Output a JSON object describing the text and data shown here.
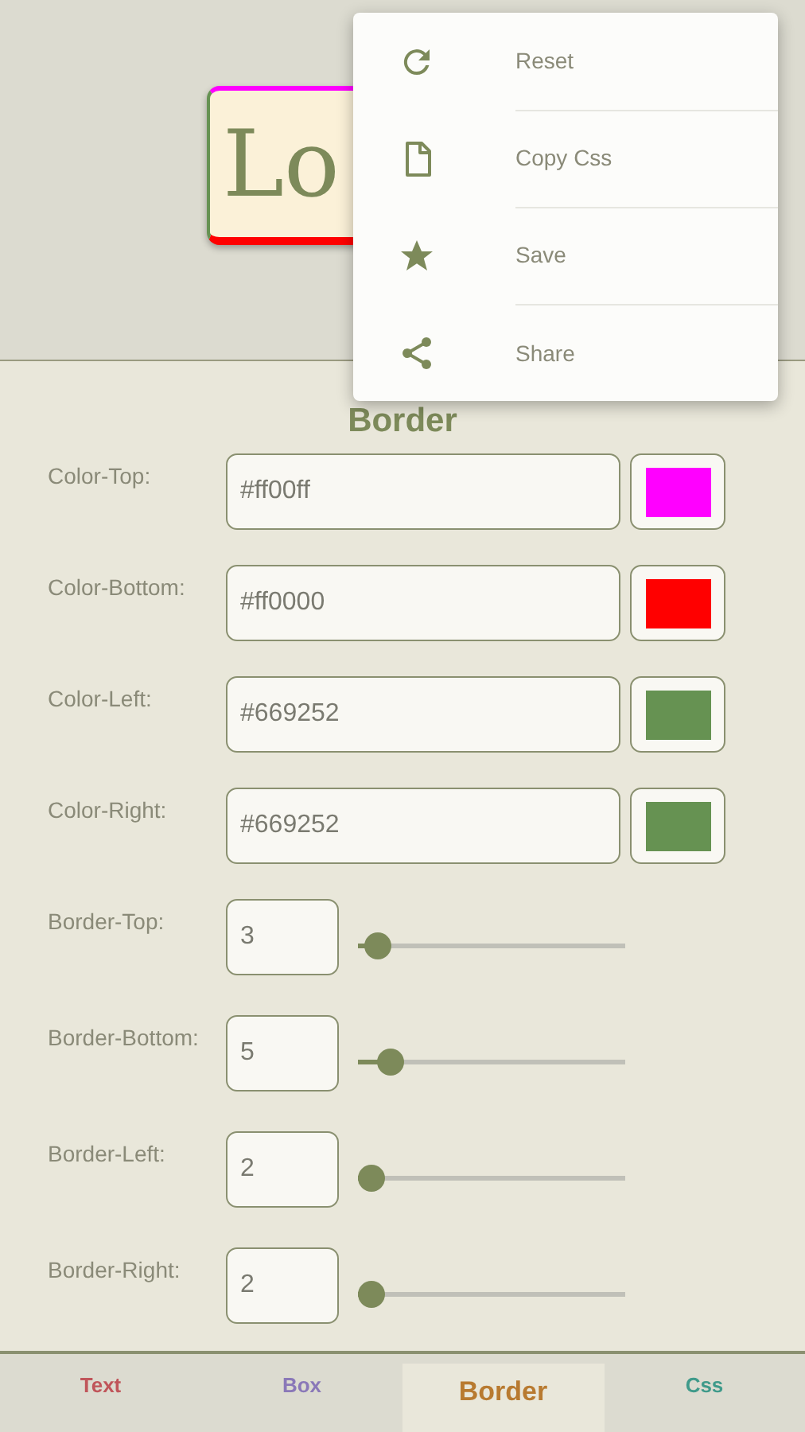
{
  "preview": {
    "text": "Lo"
  },
  "section_title": "Border",
  "color_rows": [
    {
      "label": "Color-Top:",
      "value": "#ff00ff",
      "color": "#ff00ff"
    },
    {
      "label": "Color-Bottom:",
      "value": "#ff0000",
      "color": "#ff0000"
    },
    {
      "label": "Color-Left:",
      "value": "#669252",
      "color": "#669252"
    },
    {
      "label": "Color-Right:",
      "value": "#669252",
      "color": "#669252"
    }
  ],
  "width_rows": [
    {
      "label": "Border-Top:",
      "value": "3",
      "level": 0.07
    },
    {
      "label": "Border-Bottom:",
      "value": "5",
      "level": 0.12
    },
    {
      "label": "Border-Left:",
      "value": "2",
      "level": 0.05
    },
    {
      "label": "Border-Right:",
      "value": "2",
      "level": 0.05
    }
  ],
  "tabs": [
    {
      "label": "Text",
      "selected": false,
      "color": "#c0555a"
    },
    {
      "label": "Box",
      "selected": false,
      "color": "#8a78b8"
    },
    {
      "label": "Border",
      "selected": true,
      "color": "#b87a30"
    },
    {
      "label": "Css",
      "selected": false,
      "color": "#3f9a8a"
    }
  ],
  "menu": [
    {
      "label": "Reset",
      "kind": "reset"
    },
    {
      "label": "Copy Css",
      "kind": "copy"
    },
    {
      "label": "Save",
      "kind": "save"
    },
    {
      "label": "Share",
      "kind": "share"
    }
  ]
}
